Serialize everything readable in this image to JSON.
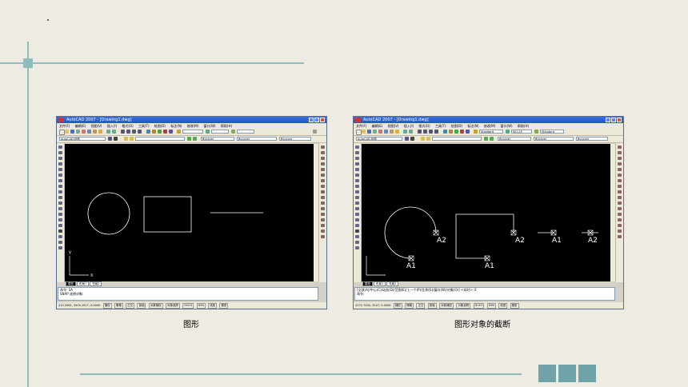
{
  "screen1": {
    "title": "AutoCAD 2007 - [Drawing1.dwg]",
    "menu": [
      "文件(F)",
      "编辑(E)",
      "视图(V)",
      "插入(I)",
      "格式(O)",
      "工具(T)",
      "绘图(D)",
      "标注(N)",
      "修改(M)",
      "窗口(W)",
      "帮助(H)"
    ],
    "workspace": "AutoCAD 经典",
    "layer_combo": "ByLayer",
    "tabs": [
      "模型",
      "布局1",
      "布局2"
    ],
    "cmd_lines": [
      "命令: SA",
      "SNAP 选择对象:"
    ],
    "coords": "210.2061, 3205.1917, 0.0000",
    "status_buttons": [
      "捕捉",
      "栅格",
      "正交",
      "极轴",
      "对象捕捉",
      "对象追踪",
      "DUCS",
      "DYN",
      "线宽",
      "模型"
    ],
    "caption": "图形"
  },
  "screen2": {
    "title": "AutoCAD 2007 - [Drawing1.dwg]",
    "workspace": "AutoCAD 经典",
    "style_combo": "Standard",
    "dim_combo": "ISO-25",
    "style_combo2": "Standard",
    "layer_combo": "ByLayer",
    "tabs": [
      "模型",
      "布局1",
      "布局2"
    ],
    "cmd_lines": [
      "[全部(A)/中心(C)/动态(D)/范围(E)/上一个(P)/比例(S)/窗口(W)/对象(O)] <实时>: E",
      "命令:"
    ],
    "coords": "2272.7050, 3247, 0.0000",
    "status_buttons": [
      "捕捉",
      "栅格",
      "正交",
      "极轴",
      "对象捕捉",
      "对象追踪",
      "DUCS",
      "DYN",
      "线宽",
      "模型"
    ],
    "labels": [
      "A1",
      "A2",
      "A1",
      "A2",
      "A1",
      "A2"
    ],
    "caption": "图形对象的截断"
  },
  "axis": {
    "x": "X",
    "y": "Y"
  }
}
